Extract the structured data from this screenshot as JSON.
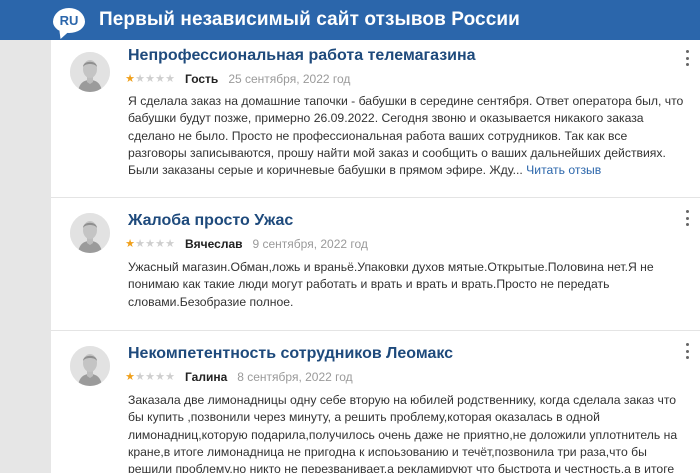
{
  "header": {
    "badge": "RU",
    "title": "Первый независимый сайт отзывов России"
  },
  "reviews": [
    {
      "title": "Непрофессиональная работа телемагазина",
      "rating": 1,
      "max_rating": 5,
      "author": "Гость",
      "date": "25 сентября, 2022 год",
      "text": "Я сделала заказ на домашние тапочки - бабушки в середине сентября. Ответ оператора был, что бабушки будут позже, примерно 26.09.2022. Сегодня звоню и оказывается никакого заказа сделано не было. Просто не профессиональная работа ваших сотрудников. Так как все разговоры записываются, прошу найти мой заказ и сообщить о ваших дальнейших действиях. Были заказаны серые и коричневые бабушки в прямом эфире. Жду...",
      "more": "Читать отзыв"
    },
    {
      "title": "Жалоба просто Ужас",
      "rating": 1,
      "max_rating": 5,
      "author": "Вячеслав",
      "date": "9 сентября, 2022 год",
      "text": "Ужасный магазин.Обман,ложь и враньё.Упаковки духов мятые.Открытые.Половина нет.Я не понимаю как такие люди могут работать и врать и врать и врать.Просто не передать словами.Безобразие полное."
    },
    {
      "title": "Некомпетентность сотрудников Леомакс",
      "rating": 1,
      "max_rating": 5,
      "author": "Галина",
      "date": "8 сентября, 2022 год",
      "text": "Заказала две лимонадницы одну себе вторую на юбилей родственнику, когда сделала заказ что бы купить ,позвонили через минуту, а решить проблему,которая оказалась в одной лимонадниц,которую подарила,получилось очень даже не приятно,не доложили уплотнитель на кране,в итоге лимонадница не пригодна к испоьзованию и течёт,позвонила три раза,что бы решили проблему,но никто не перезванивает,а рекламируют что быстрота и честность,а в итоге ничего из сказанного."
    }
  ],
  "icons": {
    "avatar": "user-avatar-icon",
    "star_on": "star-filled-icon",
    "star_off": "star-empty-icon",
    "menu": "more-vertical-icon"
  },
  "colors": {
    "header_bg": "#2b66ab",
    "title": "#1e4a7c",
    "star": "#f0a01b",
    "link": "#2b66ab"
  }
}
